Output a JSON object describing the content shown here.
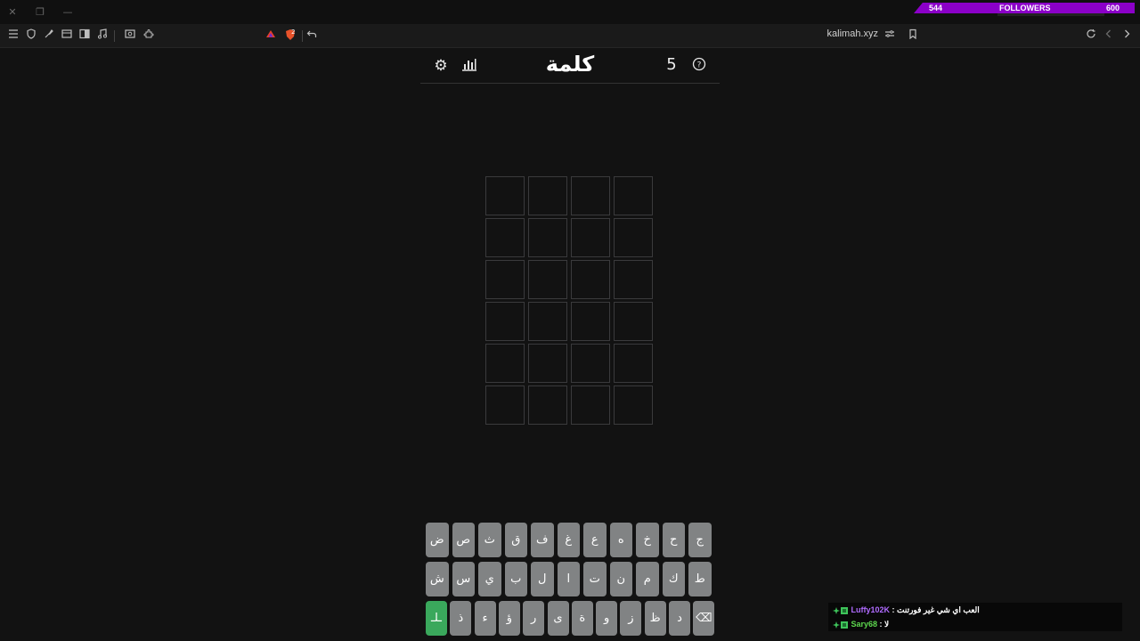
{
  "window": {
    "close_glyph": "✕",
    "restore_glyph": "❐",
    "minimize_glyph": "—"
  },
  "toolbar": {
    "url": "kalimah.xyz",
    "shields_badge": "2"
  },
  "followers": {
    "current": "544",
    "label": "FOLLOWERS",
    "goal": "600"
  },
  "game": {
    "title": "كلمة",
    "streak": "5",
    "settings_glyph": "⚙",
    "stats_glyph": "▥",
    "help_glyph": "?",
    "rows": 6,
    "cols": 4
  },
  "keyboard": {
    "row1": [
      "ض",
      "ص",
      "ث",
      "ق",
      "ف",
      "غ",
      "ع",
      "ه",
      "خ",
      "ح",
      "ج"
    ],
    "row2": [
      "ش",
      "س",
      "ي",
      "ب",
      "ل",
      "ا",
      "ت",
      "ن",
      "م",
      "ك",
      "ط"
    ],
    "row3": [
      "ـلـ",
      "ذ",
      "ء",
      "ؤ",
      "ر",
      "ى",
      "ة",
      "و",
      "ز",
      "ظ",
      "د",
      "⌫"
    ]
  },
  "chat": [
    {
      "user": "Luffy102K",
      "sep": " : ",
      "message": "العب اي شي غير فورتنت"
    },
    {
      "user": "Sary68",
      "sep": " : ",
      "message": "لا"
    }
  ],
  "colors": {
    "background": "#121212",
    "key": "#818384",
    "enter_key": "#3aa85c",
    "followers_bar": "#8b00c8"
  }
}
